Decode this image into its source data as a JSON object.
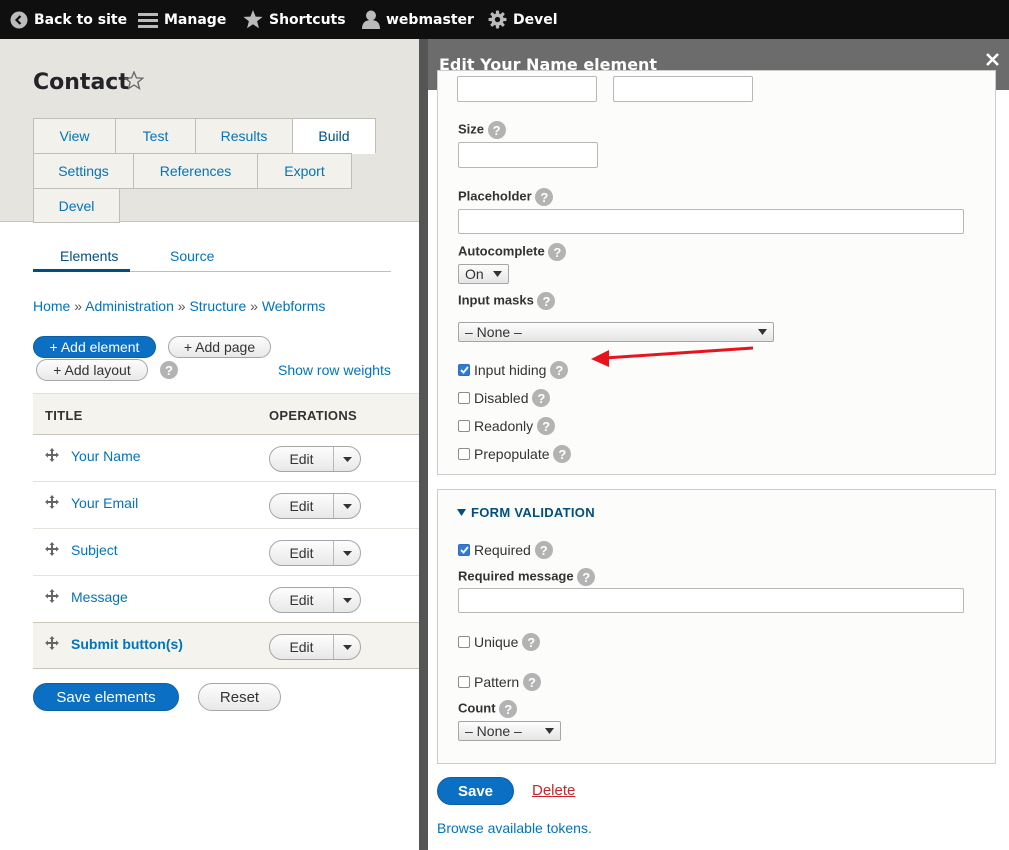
{
  "toolbar": {
    "back": "Back to site",
    "manage": "Manage",
    "shortcuts": "Shortcuts",
    "user": "webmaster",
    "devel": "Devel"
  },
  "page": {
    "title": "Contact",
    "primary_tabs": [
      {
        "label": "View"
      },
      {
        "label": "Test"
      },
      {
        "label": "Results"
      },
      {
        "label": "Build",
        "active": true
      },
      {
        "label": "Settings"
      },
      {
        "label": "References"
      },
      {
        "label": "Export"
      },
      {
        "label": "Devel"
      }
    ],
    "secondary_tabs": [
      {
        "label": "Elements",
        "active": true
      },
      {
        "label": "Source"
      }
    ],
    "breadcrumb": [
      "Home",
      "Administration",
      "Structure",
      "Webforms"
    ],
    "breadcrumb_sep": "»",
    "actions": {
      "add_element": "+ Add element",
      "add_page": "+ Add page",
      "add_layout": "+ Add layout",
      "show_row_weights": "Show row weights"
    },
    "table": {
      "headers": [
        "TITLE",
        "OPERATIONS"
      ],
      "rows": [
        {
          "title": "Your Name",
          "op": "Edit"
        },
        {
          "title": "Your Email",
          "op": "Edit"
        },
        {
          "title": "Subject",
          "op": "Edit"
        },
        {
          "title": "Message",
          "op": "Edit"
        },
        {
          "title": "Submit button(s)",
          "op": "Edit"
        }
      ]
    },
    "save_elements": "Save elements",
    "reset": "Reset"
  },
  "dialog": {
    "title": "Edit Your Name element",
    "size_label": "Size",
    "placeholder_label": "Placeholder",
    "autocomplete_label": "Autocomplete",
    "autocomplete_value": "On",
    "input_masks_label": "Input masks",
    "input_masks_value": "– None –",
    "checkboxes": [
      {
        "label": "Input hiding",
        "checked": true
      },
      {
        "label": "Disabled",
        "checked": false
      },
      {
        "label": "Readonly",
        "checked": false
      },
      {
        "label": "Prepopulate",
        "checked": false
      }
    ],
    "validation": {
      "heading": "FORM VALIDATION",
      "required_label": "Required",
      "required_message_label": "Required message",
      "unique_label": "Unique",
      "pattern_label": "Pattern",
      "count_label": "Count",
      "count_value": "– None –"
    },
    "save": "Save",
    "delete": "Delete",
    "browse_tokens": "Browse available tokens."
  },
  "colors": {
    "toolbar_bg": "#0f0f0f",
    "link": "#0074bd",
    "primary_button": "#0b6fc4",
    "annotation_arrow": "#e8141d",
    "dialog_header": "#6c6c6c"
  }
}
